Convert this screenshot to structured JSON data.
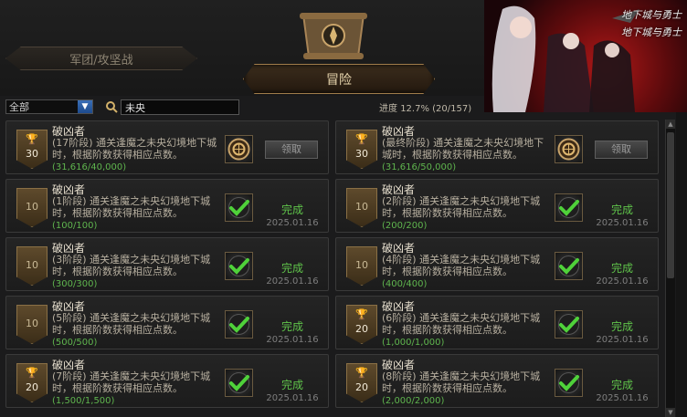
{
  "tabs": {
    "guild": "军团/攻坚战",
    "adventure": "冒险"
  },
  "banner": {
    "logo_a": "地下城与勇士",
    "logo_b": "地下城与勇士"
  },
  "filter": {
    "category": "全部",
    "search_value": "未央"
  },
  "progress": {
    "label": "进度",
    "value": "12.7% (20/157)"
  },
  "colors": {
    "complete": "#5fc34a",
    "gold": "#a07c4a"
  },
  "cards": [
    {
      "title": "破凶者",
      "desc": "(17阶段) 通关逢魔之未央幻境地下城时，根据阶数获得相应点数。",
      "progress": "(31,616/40,000)",
      "points": "30",
      "trophy": true,
      "reward_icon": "emblem-icon",
      "action": "领取",
      "date": ""
    },
    {
      "title": "破凶者",
      "desc": "(最终阶段) 通关逢魔之未央幻境地下城时，根据阶数获得相应点数。",
      "progress": "(31,616/50,000)",
      "points": "30",
      "trophy": true,
      "reward_icon": "emblem-icon",
      "action": "领取",
      "date": ""
    },
    {
      "title": "破凶者",
      "desc": "(1阶段) 通关逢魔之未央幻境地下城时，根据阶数获得相应点数。",
      "progress": "(100/100)",
      "points": "10",
      "trophy": false,
      "reward_icon": "check-icon",
      "action": "完成",
      "date": "2025.01.16"
    },
    {
      "title": "破凶者",
      "desc": "(2阶段) 通关逢魔之未央幻境地下城时，根据阶数获得相应点数。",
      "progress": "(200/200)",
      "points": "10",
      "trophy": false,
      "reward_icon": "check-icon",
      "action": "完成",
      "date": "2025.01.16"
    },
    {
      "title": "破凶者",
      "desc": "(3阶段) 通关逢魔之未央幻境地下城时，根据阶数获得相应点数。",
      "progress": "(300/300)",
      "points": "10",
      "trophy": false,
      "reward_icon": "check-icon",
      "action": "完成",
      "date": "2025.01.16"
    },
    {
      "title": "破凶者",
      "desc": "(4阶段) 通关逢魔之未央幻境地下城时，根据阶数获得相应点数。",
      "progress": "(400/400)",
      "points": "10",
      "trophy": false,
      "reward_icon": "check-icon",
      "action": "完成",
      "date": "2025.01.16"
    },
    {
      "title": "破凶者",
      "desc": "(5阶段) 通关逢魔之未央幻境地下城时，根据阶数获得相应点数。",
      "progress": "(500/500)",
      "points": "10",
      "trophy": false,
      "reward_icon": "check-icon",
      "action": "完成",
      "date": "2025.01.16"
    },
    {
      "title": "破凶者",
      "desc": "(6阶段) 通关逢魔之未央幻境地下城时，根据阶数获得相应点数。",
      "progress": "(1,000/1,000)",
      "points": "20",
      "trophy": true,
      "reward_icon": "check-icon",
      "action": "完成",
      "date": "2025.01.16"
    },
    {
      "title": "破凶者",
      "desc": "(7阶段) 通关逢魔之未央幻境地下城时，根据阶数获得相应点数。",
      "progress": "(1,500/1,500)",
      "points": "20",
      "trophy": true,
      "reward_icon": "check-icon",
      "action": "完成",
      "date": "2025.01.16"
    },
    {
      "title": "破凶者",
      "desc": "(8阶段) 通关逢魔之未央幻境地下城时，根据阶数获得相应点数。",
      "progress": "(2,000/2,000)",
      "points": "20",
      "trophy": true,
      "reward_icon": "check-icon",
      "action": "完成",
      "date": "2025.01.16"
    }
  ]
}
